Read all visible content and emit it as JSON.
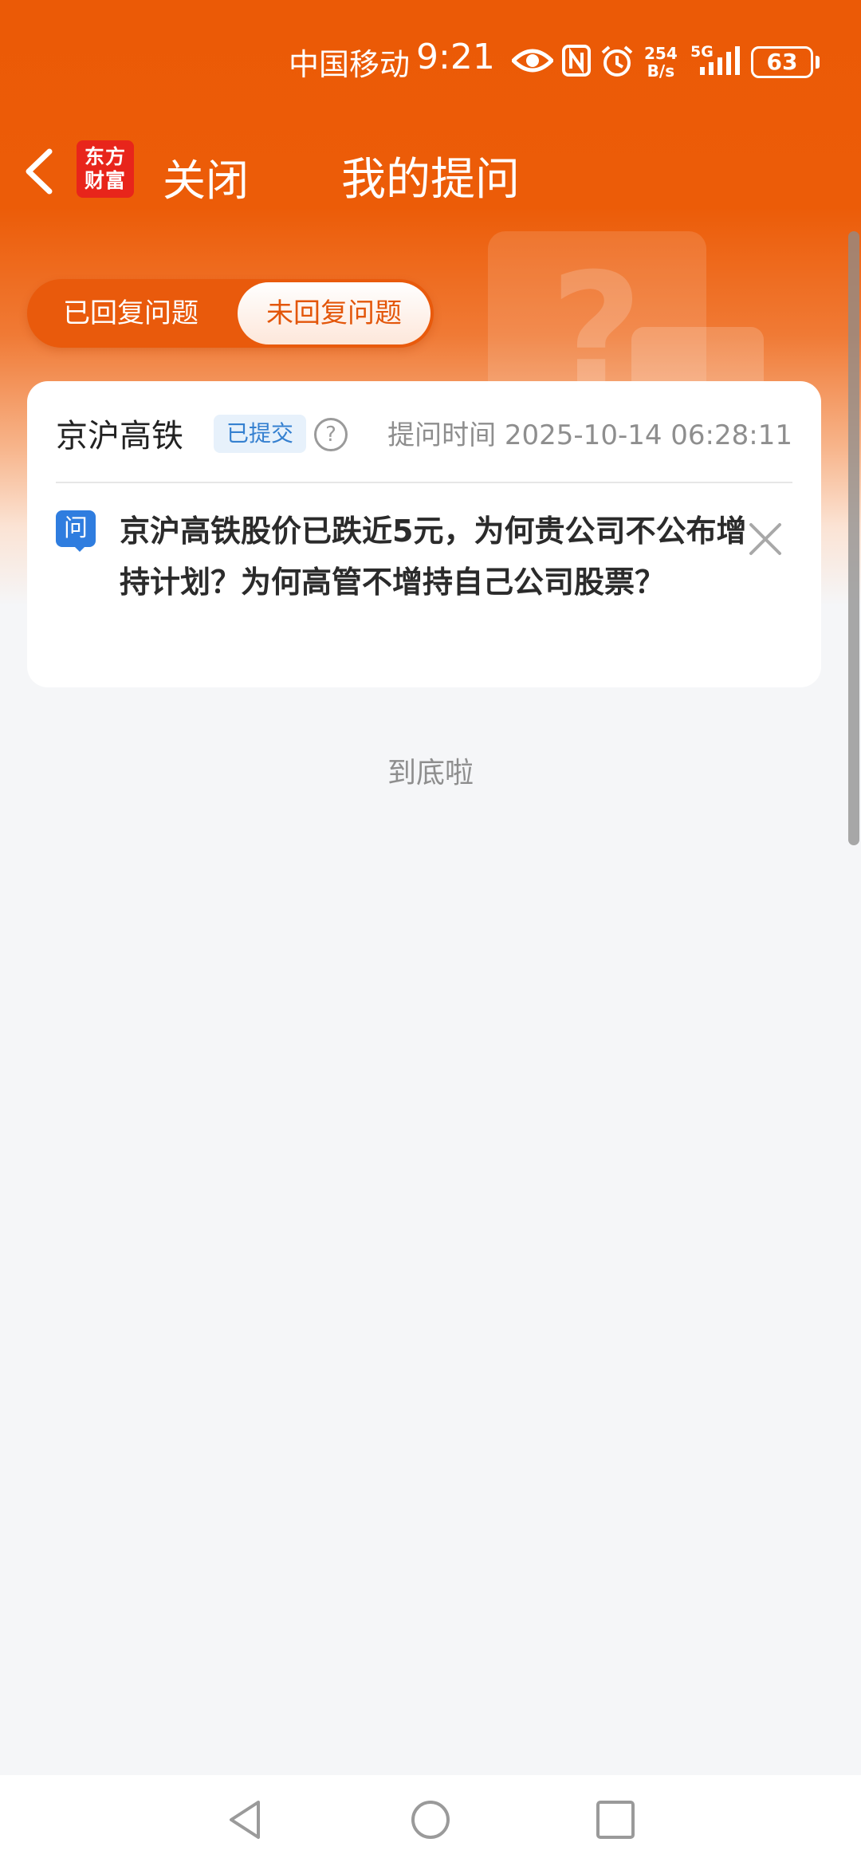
{
  "status_bar": {
    "carrier": "中国移动",
    "time": "9:21",
    "net_speed_value": "254",
    "net_speed_unit": "B/s",
    "network_type": "5G",
    "battery": "63",
    "icons": [
      "eye-icon",
      "nfc-icon",
      "alarm-icon",
      "signal-icon",
      "battery-icon"
    ]
  },
  "nav": {
    "logo_line1": "东方",
    "logo_line2": "财富",
    "close_label": "关闭",
    "title": "我的提问"
  },
  "tabs": [
    {
      "label": "已回复问题",
      "active": false
    },
    {
      "label": "未回复问题",
      "active": true
    }
  ],
  "question_card": {
    "company": "京沪高铁",
    "status": "已提交",
    "help_symbol": "?",
    "ask_time": "提问时间 2025-10-14 06:28:11",
    "question_icon_label": "问",
    "question_text": "京沪高铁股价已跌近5元，为何贵公司不公布增持计划？为何高管不增持自己公司股票？"
  },
  "end_text": "到底啦",
  "colors": {
    "brand_orange": "#eb5a06",
    "badge_blue": "#3580d0",
    "logo_red": "#e8251b"
  }
}
